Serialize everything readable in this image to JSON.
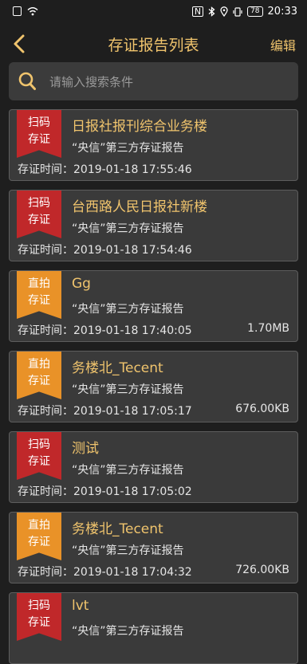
{
  "status_bar": {
    "time": "20:33",
    "battery": "78"
  },
  "nav": {
    "title": "存证报告列表",
    "edit_label": "编辑"
  },
  "search": {
    "placeholder": "请输入搜索条件"
  },
  "time_prefix": "存证时间：",
  "records": [
    {
      "badge": [
        "扫码",
        "存证"
      ],
      "badge_type": "scan",
      "title": "日报社报刊综合业务楼",
      "subtitle": "“央信”第三方存证报告",
      "time": "2019-01-18 17:55:46",
      "size": ""
    },
    {
      "badge": [
        "扫码",
        "存证"
      ],
      "badge_type": "scan",
      "title": "台西路人民日报社新楼",
      "subtitle": "“央信”第三方存证报告",
      "time": "2019-01-18 17:54:46",
      "size": ""
    },
    {
      "badge": [
        "直拍",
        "存证"
      ],
      "badge_type": "photo",
      "title": "Gg",
      "subtitle": "“央信”第三方存证报告",
      "time": "2019-01-18 17:40:05",
      "size": "1.70MB"
    },
    {
      "badge": [
        "直拍",
        "存证"
      ],
      "badge_type": "photo",
      "title": "务楼北_Tecent",
      "subtitle": "“央信”第三方存证报告",
      "time": "2019-01-18 17:05:17",
      "size": "676.00KB"
    },
    {
      "badge": [
        "扫码",
        "存证"
      ],
      "badge_type": "scan",
      "title": "测试",
      "subtitle": "“央信”第三方存证报告",
      "time": "2019-01-18 17:05:02",
      "size": ""
    },
    {
      "badge": [
        "直拍",
        "存证"
      ],
      "badge_type": "photo",
      "title": "务楼北_Tecent",
      "subtitle": "“央信”第三方存证报告",
      "time": "2019-01-18 17:04:32",
      "size": "726.00KB"
    },
    {
      "badge": [
        "扫码",
        "存证"
      ],
      "badge_type": "scan",
      "title": "lvt",
      "subtitle": "“央信”第三方存证报告",
      "time": "",
      "size": ""
    }
  ],
  "colors": {
    "accent": "#f0c46d",
    "background": "#1e1e1e",
    "card": "#3a3a3a",
    "scan_badge": "#c0282a",
    "photo_badge": "#e99228"
  }
}
